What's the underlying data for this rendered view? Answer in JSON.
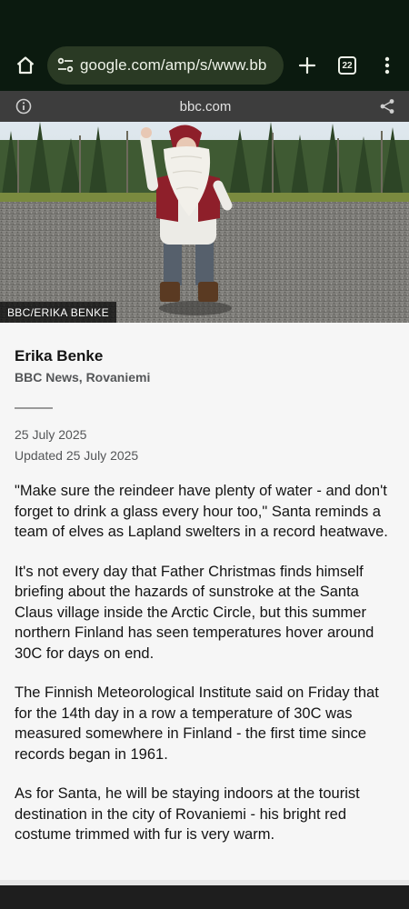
{
  "browser": {
    "url": "google.com/amp/s/www.bb",
    "tab_count": "22",
    "home_icon": "home-icon",
    "site_settings_icon": "tune-icon",
    "new_tab_icon": "plus-icon",
    "menu_icon": "more-vert-icon"
  },
  "amp_header": {
    "domain": "bbc.com",
    "info_icon": "info-icon",
    "share_icon": "share-icon"
  },
  "hero": {
    "credit": "BBC/ERIKA BENKE"
  },
  "article": {
    "author": "Erika Benke",
    "author_role": "BBC News, Rovaniemi",
    "date": "25 July 2025",
    "updated": "Updated 25 July 2025",
    "paragraphs": [
      "\"Make sure the reindeer have plenty of water - and don't forget to drink a glass every hour too,\" Santa reminds a team of elves as Lapland swelters in a record heatwave.",
      "It's not every day that Father Christmas finds himself briefing about the hazards of sunstroke at the Santa Claus village inside the Arctic Circle, but this summer northern Finland has seen temperatures hover around 30C for days on end.",
      "The Finnish Meteorological Institute said on Friday that for the 14th day in a row a temperature of 30C was measured somewhere in Finland - the first time since records began in 1961.",
      "As for Santa, he will be staying indoors at the tourist destination in the city of Rovaniemi - his bright red costume trimmed with fur is very warm."
    ]
  },
  "colors": {
    "toolbar_bg": "#0b1a0f",
    "url_pill_bg": "#2a3a24",
    "amp_bar_bg": "#3d3d3d",
    "page_bg": "#f6f6f6",
    "santa_red": "#8e1f2a"
  }
}
